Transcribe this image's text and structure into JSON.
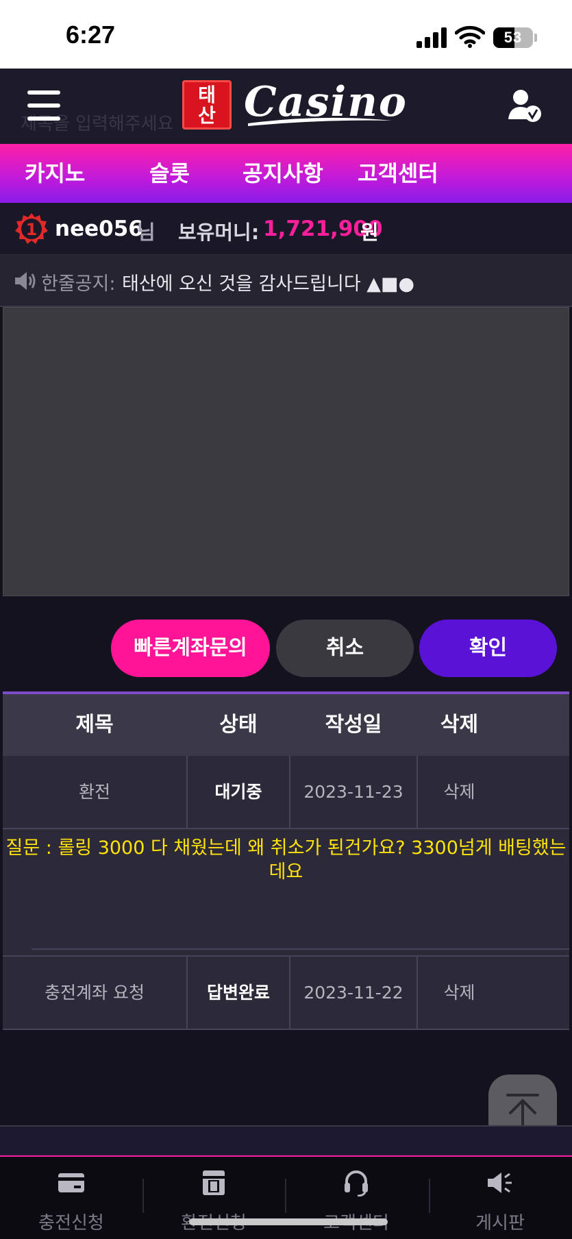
{
  "status_bar": {
    "time": "6:27",
    "battery": "53",
    "battery_level": 0.53
  },
  "header": {
    "logo_badge_top": "태",
    "logo_badge_bottom": "산",
    "logo_text": "Casino",
    "ghost_placeholder": "제목을 입력해주세요"
  },
  "nav": {
    "items": [
      "카지노",
      "슬롯",
      "공지사항",
      "고객센터"
    ]
  },
  "user": {
    "level": "1",
    "name": "nee056",
    "honorific": "님",
    "money_label": "보유머니:",
    "money_value": "1,721,900",
    "money_unit": "원"
  },
  "notice": {
    "label": "한줄공지:",
    "text": "태산에 오신 것을 감사드립니다 ▲■●"
  },
  "buttons": {
    "quick": "빠른계좌문의",
    "cancel": "취소",
    "confirm": "확인"
  },
  "table": {
    "headers": [
      "제목",
      "상태",
      "작성일",
      "삭제"
    ],
    "rows": [
      {
        "title": "환전",
        "status": "대기중",
        "date": "2023-11-23",
        "delete": "삭제"
      },
      {
        "title": "충전계좌 요청",
        "status": "답변완료",
        "date": "2023-11-22",
        "delete": "삭제"
      }
    ],
    "question": "질문 : 롤링 3000 다 채웠는데 왜 취소가 된건가요? 3300넘게 배팅했는데요"
  },
  "bottom_nav": {
    "items": [
      {
        "label": "충전신청",
        "icon": "card-icon"
      },
      {
        "label": "환전신청",
        "icon": "cash-machine-icon"
      },
      {
        "label": "고객센터",
        "icon": "headset-icon"
      },
      {
        "label": "게시판",
        "icon": "megaphone-icon"
      }
    ]
  },
  "colors": {
    "accent_pink": "#ff1497",
    "accent_purple": "#5a12d6",
    "question_yellow": "#ffe30a",
    "money_pink": "#ff1f9d"
  }
}
